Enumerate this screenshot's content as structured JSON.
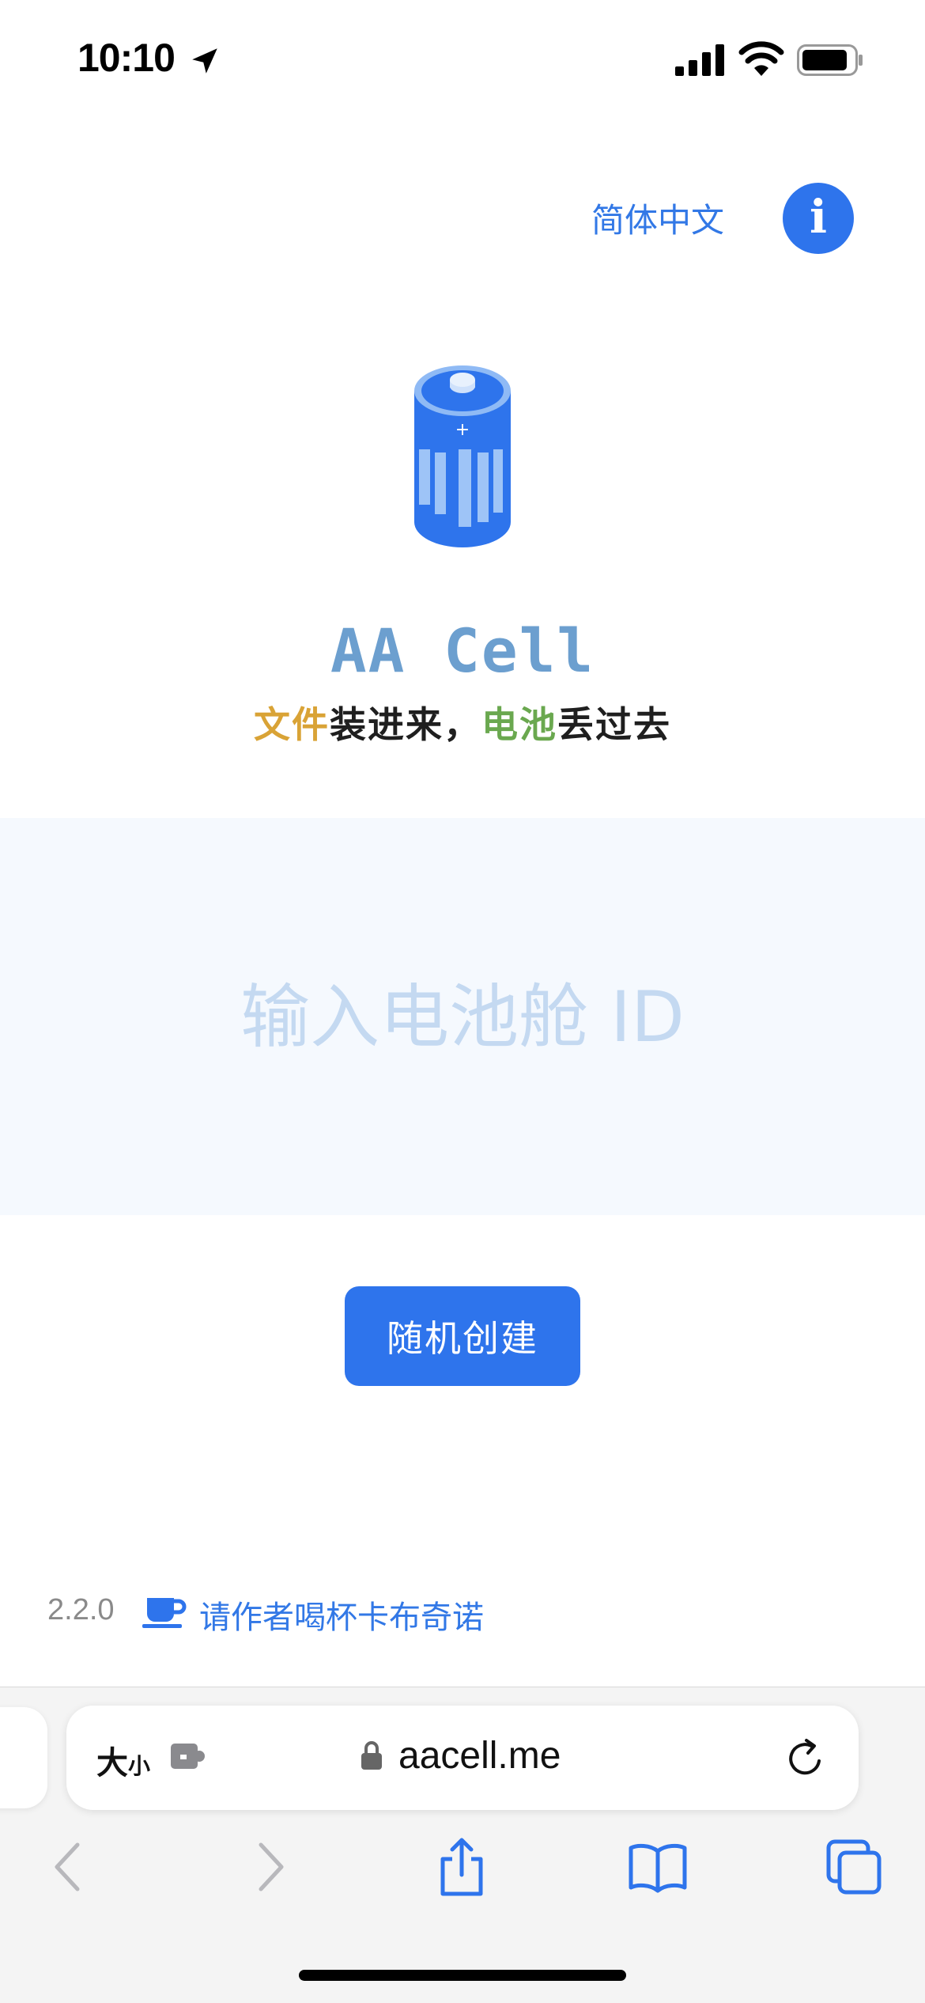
{
  "status_bar": {
    "time": "10:10",
    "icons": [
      "location-arrow-icon",
      "cellular-signal-icon",
      "wifi-icon",
      "battery-icon"
    ]
  },
  "header": {
    "language_label": "简体中文",
    "info_icon_glyph": "i",
    "accent_color": "#2e74ec"
  },
  "hero": {
    "logo_icon": "battery-icon",
    "title": "AA Cell",
    "slogan": {
      "part1": "文件",
      "part2": "装进来，",
      "part3": "电池",
      "part4": "丢过去"
    },
    "slogan_colors": {
      "file": "#d9a336",
      "cell": "#6aa84f"
    }
  },
  "main": {
    "id_input_placeholder": "输入电池舱 ID",
    "id_input_value": "",
    "create_button_label": "随机创建"
  },
  "footer": {
    "version": "2.2.0",
    "coffee_icon": "coffee-cup-icon",
    "coffee_link_label": "请作者喝杯卡布奇诺"
  },
  "browser": {
    "text_size_label_big": "大",
    "text_size_label_small": "小",
    "url": "aacell.me",
    "toolbar_icons": [
      "back-icon",
      "forward-icon",
      "share-icon",
      "bookmarks-icon",
      "tabs-icon"
    ]
  }
}
